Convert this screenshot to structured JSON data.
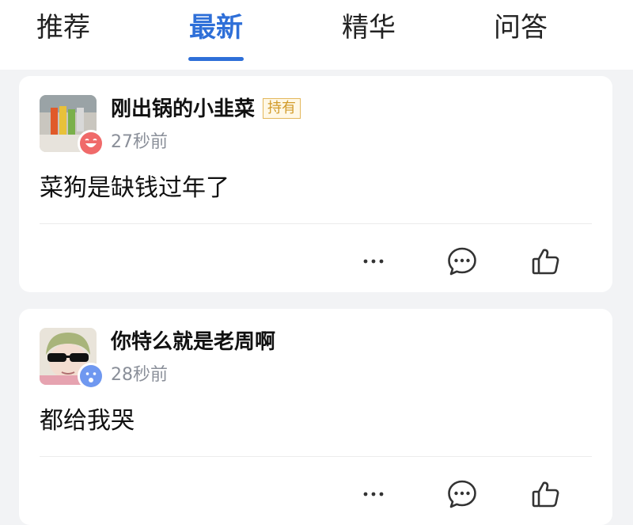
{
  "tabs": [
    {
      "label": "推荐",
      "active": false
    },
    {
      "label": "最新",
      "active": true
    },
    {
      "label": "精华",
      "active": false
    },
    {
      "label": "问答",
      "active": false
    }
  ],
  "accent_color": "#2e6fd8",
  "posts": [
    {
      "username": "刚出锅的小韭菜",
      "tag": "持有",
      "timestamp": "27秒前",
      "content": "菜狗是缺钱过年了",
      "badge_icon": "grinning-face-icon"
    },
    {
      "username": "你特么就是老周啊",
      "tag": "",
      "timestamp": "28秒前",
      "content": "都给我哭",
      "badge_icon": "surprised-face-icon"
    }
  ],
  "actions": [
    "more-icon",
    "comment-icon",
    "thumbs-up-icon"
  ]
}
